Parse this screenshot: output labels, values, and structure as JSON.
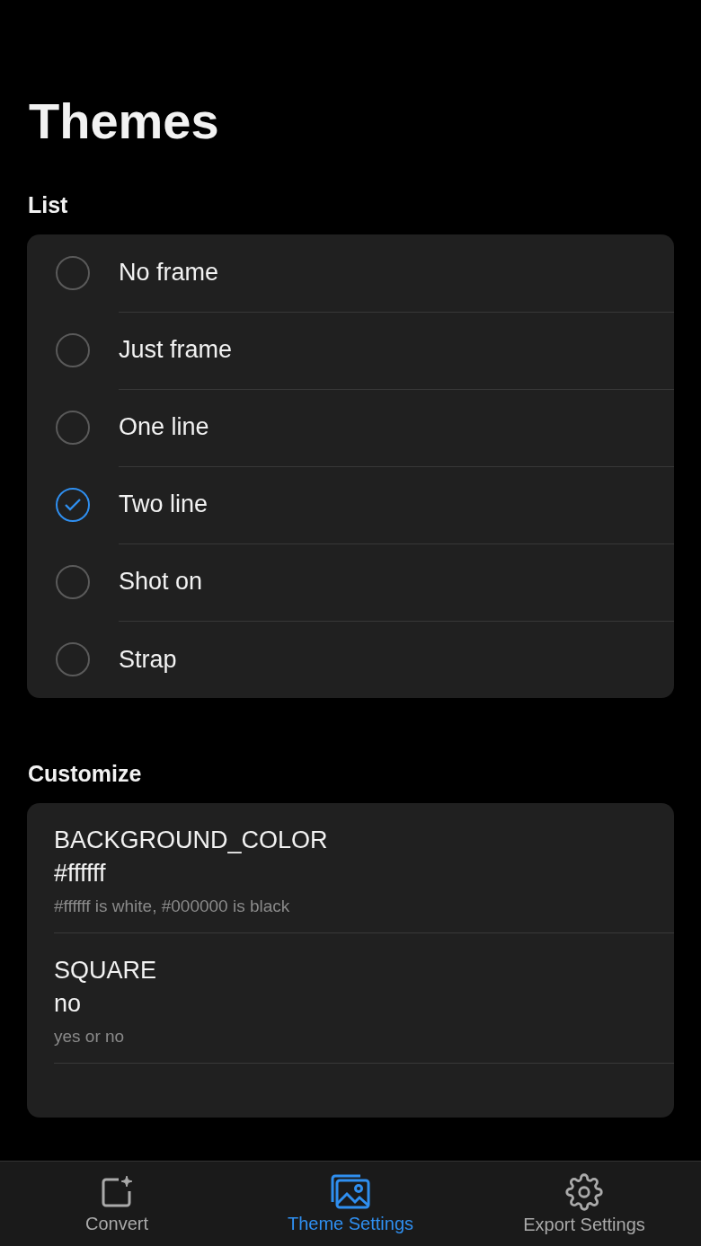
{
  "title": "Themes",
  "list": {
    "heading": "List",
    "items": [
      {
        "label": "No frame",
        "selected": false
      },
      {
        "label": "Just frame",
        "selected": false
      },
      {
        "label": "One line",
        "selected": false
      },
      {
        "label": "Two line",
        "selected": true
      },
      {
        "label": "Shot on",
        "selected": false
      },
      {
        "label": "Strap",
        "selected": false
      }
    ]
  },
  "customize": {
    "heading": "Customize",
    "items": [
      {
        "name": "BACKGROUND_COLOR",
        "value": "#ffffff",
        "hint": "#ffffff is white, #000000 is black"
      },
      {
        "name": "SQUARE",
        "value": "no",
        "hint": "yes or no"
      }
    ]
  },
  "nav": [
    {
      "kind": "convert",
      "label": "Convert",
      "selected": false
    },
    {
      "kind": "image",
      "label": "Theme Settings",
      "selected": true
    },
    {
      "kind": "gear",
      "label": "Export Settings",
      "selected": false
    }
  ]
}
